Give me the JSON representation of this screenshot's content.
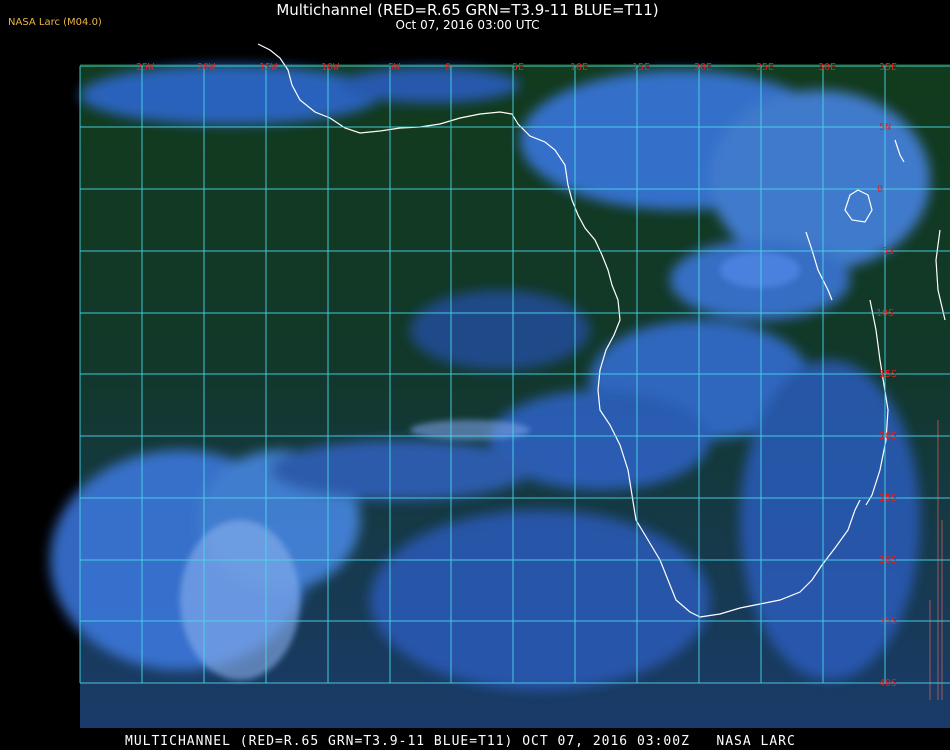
{
  "header": {
    "title": "Multichannel (RED=R.65 GRN=T3.9-11 BLUE=T11)",
    "subtitle": "Oct 07, 2016 03:00 UTC",
    "version": "NASA Larc (M04.0)"
  },
  "footer": {
    "text": "MULTICHANNEL (RED=R.65 GRN=T3.9-11 BLUE=T11) OCT 07, 2016 03:00Z   NASA LARC"
  },
  "map": {
    "longitude_labels": [
      "25W",
      "20W",
      "15W",
      "10W",
      "5W",
      "0",
      "5E",
      "10E",
      "15E",
      "20E",
      "25E",
      "30E",
      "35E"
    ],
    "latitude_labels": [
      "5N",
      "0",
      "5S",
      "10S",
      "15S",
      "20S",
      "25S",
      "30S",
      "35S",
      "40S"
    ],
    "colors": {
      "grid": "#48d8e8",
      "label": "#e02020",
      "ocean_dark": "#0e3018",
      "cloud": "#3a72e6",
      "coast": "#ffffff"
    }
  }
}
